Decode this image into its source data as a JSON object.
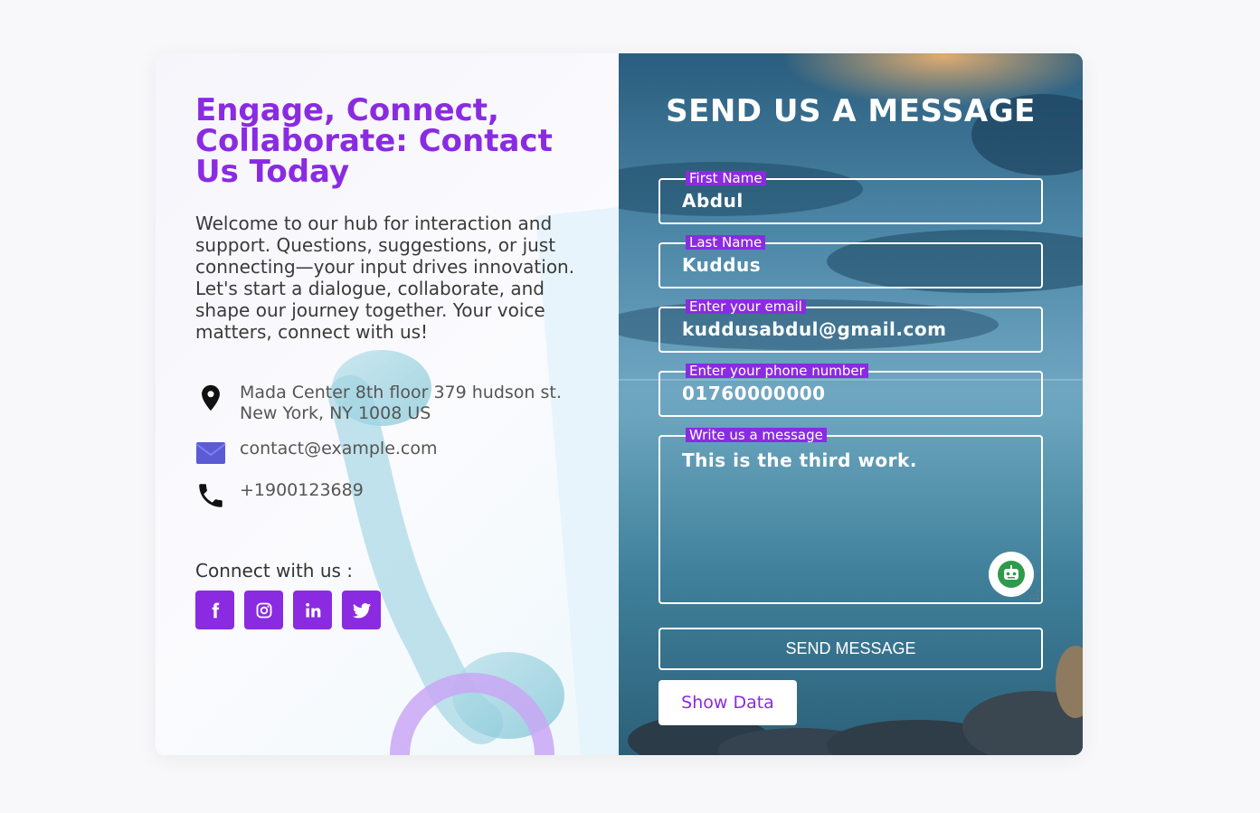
{
  "colors": {
    "accent": "#8a2be2",
    "page_bg": "#f8f8fa"
  },
  "left": {
    "title": "Engage, Connect, Collaborate: Contact Us Today",
    "intro": "Welcome to our hub for interaction and support. Questions, suggestions, or just connecting—your input drives innovation. Let's start a dialogue, collaborate, and shape our journey together. Your voice matters, connect with us!",
    "address_line1": "Mada Center 8th floor 379 hudson st.",
    "address_line2": "New York, NY 1008 US",
    "email": "contact@example.com",
    "phone": "+1900123689",
    "connect_label": "Connect with us :",
    "socials": [
      {
        "icon": "facebook-icon"
      },
      {
        "icon": "instagram-icon"
      },
      {
        "icon": "linkedin-icon"
      },
      {
        "icon": "twitter-icon"
      }
    ]
  },
  "form": {
    "title": "SEND US A MESSAGE",
    "first_name": {
      "label": "First Name",
      "value": "Abdul"
    },
    "last_name": {
      "label": "Last Name",
      "value": "Kuddus"
    },
    "email": {
      "label": "Enter your email",
      "value": "kuddusabdul@gmail.com"
    },
    "phone": {
      "label": "Enter your phone number",
      "value": "01760000000"
    },
    "message": {
      "label": "Write us a message",
      "value": "This is the third work."
    },
    "send_label": "SEND MESSAGE",
    "show_label": "Show Data"
  }
}
